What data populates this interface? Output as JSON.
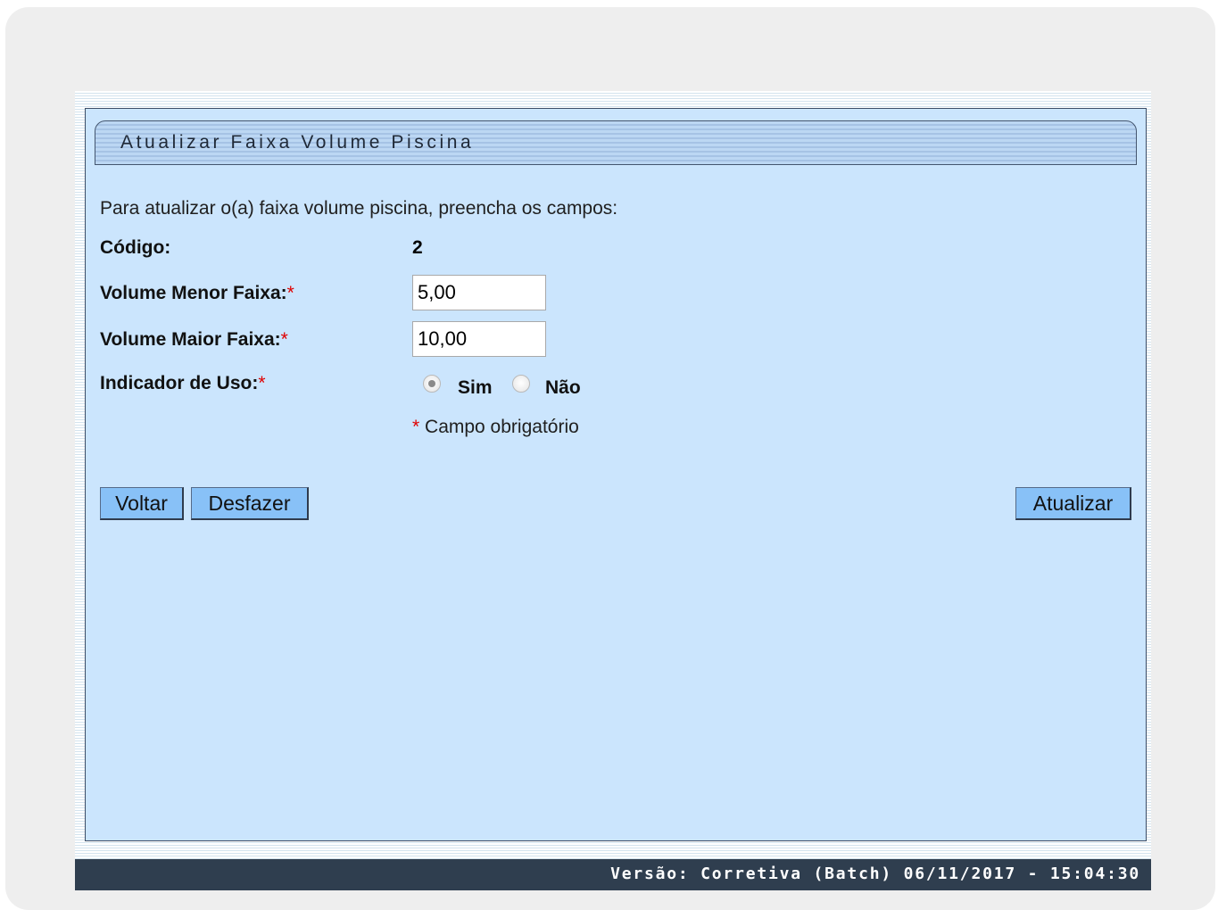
{
  "header": {
    "title": "Atualizar Faixa Volume Piscina"
  },
  "form": {
    "intro": "Para atualizar o(a) faixa volume piscina, preencha os campos:",
    "codigo_label": "Código:",
    "codigo_value": "2",
    "volume_menor_label": "Volume Menor Faixa:",
    "volume_menor_value": "5,00",
    "volume_maior_label": "Volume Maior Faixa:",
    "volume_maior_value": "10,00",
    "indicador_label": "Indicador de Uso:",
    "required_mark": "*",
    "options": [
      {
        "label": "Sim",
        "checked": true
      },
      {
        "label": "Não",
        "checked": false
      }
    ],
    "required_note": "Campo obrigatório"
  },
  "buttons": {
    "voltar": "Voltar",
    "desfazer": "Desfazer",
    "atualizar": "Atualizar"
  },
  "footer": {
    "version": "Versão: Corretiva (Batch) 06/11/2017 - 15:04:30"
  },
  "colors": {
    "panel_bg": "#cbe5fd",
    "button_bg": "#88c1f7",
    "footer_bg": "#2f3e4f",
    "required": "#e00000"
  }
}
